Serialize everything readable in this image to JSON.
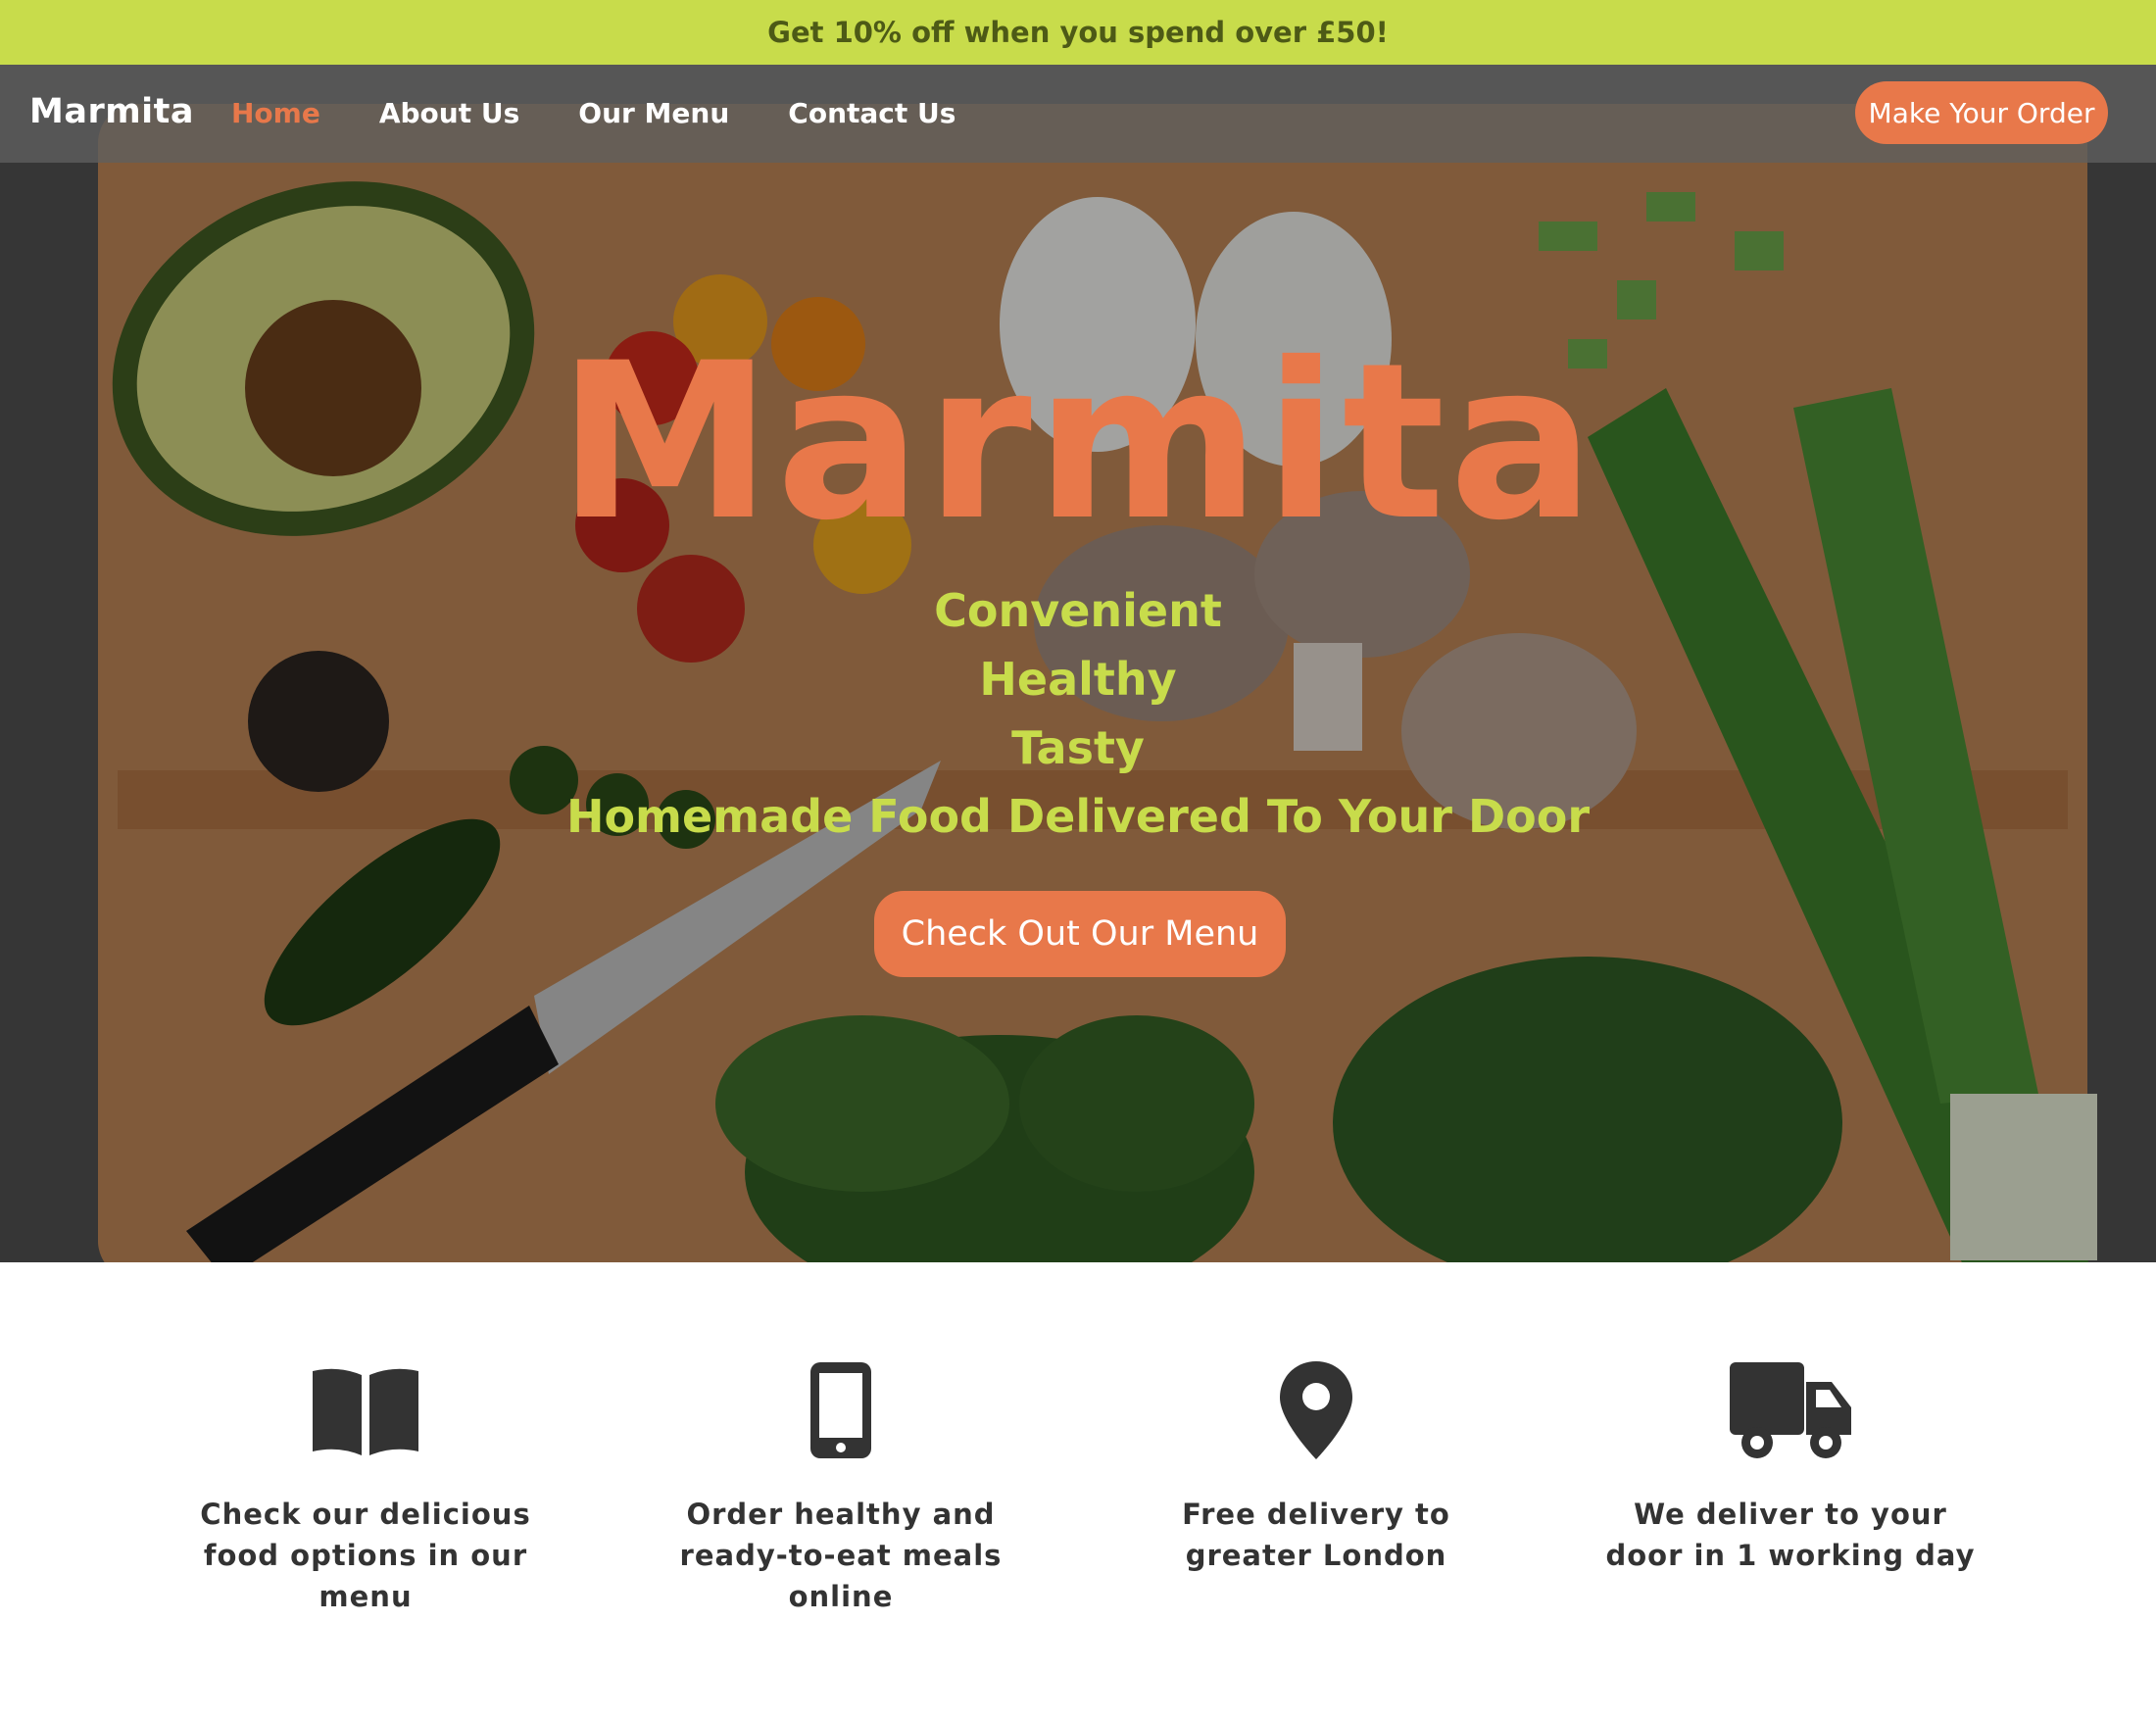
{
  "promo": {
    "text": "Get 10% off when you spend over £50!"
  },
  "nav": {
    "brand": "Marmita",
    "links": [
      {
        "label": "Home",
        "active": true
      },
      {
        "label": "About Us"
      },
      {
        "label": "Our Menu"
      },
      {
        "label": "Contact Us"
      }
    ],
    "cta": "Make Your Order"
  },
  "hero": {
    "title": "Marmita",
    "taglines": [
      "Convenient",
      "Healthy",
      "Tasty",
      "Homemade Food Delivered To Your Door"
    ],
    "button": "Check Out Our Menu"
  },
  "features": [
    {
      "icon": "book-open-icon",
      "text": "Check our delicious food options in our menu"
    },
    {
      "icon": "mobile-phone-icon",
      "text": "Order healthy and ready-to-eat meals online"
    },
    {
      "icon": "map-pin-icon",
      "text": "Free delivery to greater London"
    },
    {
      "icon": "delivery-truck-icon",
      "text": "We deliver to your door in 1 working day"
    }
  ],
  "colors": {
    "accent": "#e8784a",
    "lime": "#c8dc4b",
    "dark_text": "#333333"
  }
}
